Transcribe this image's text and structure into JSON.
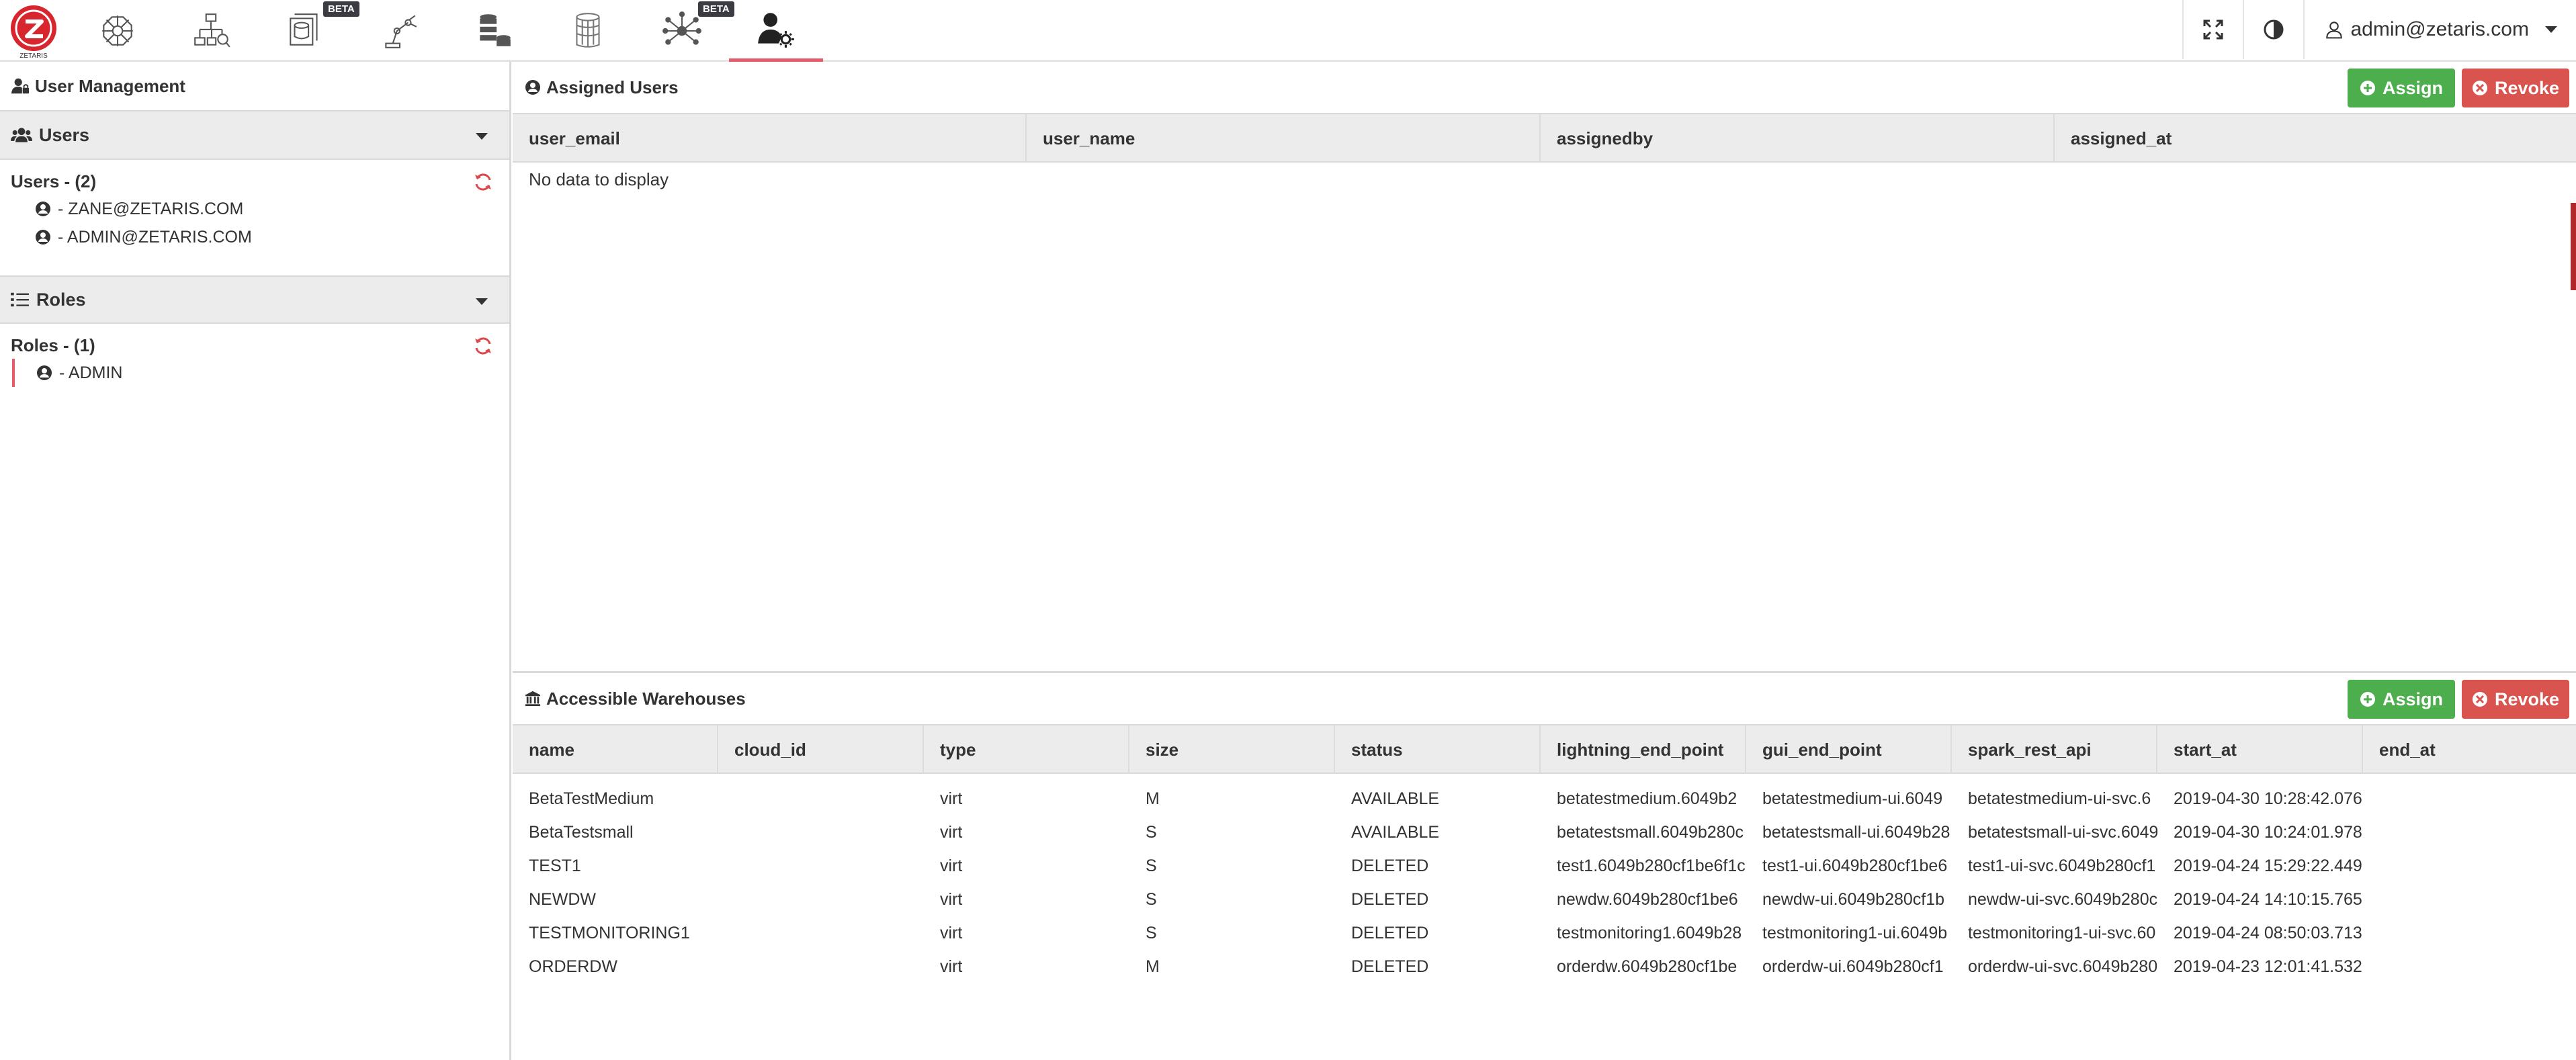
{
  "brand": {
    "logo_text": "ZETARIS",
    "accent": "#e35d6a"
  },
  "topnav": {
    "items": [
      {
        "icon": "network-hub-icon",
        "beta": ""
      },
      {
        "icon": "hierarchy-search-icon",
        "beta": ""
      },
      {
        "icon": "data-stack-icon",
        "beta": "BETA"
      },
      {
        "icon": "robot-arm-icon",
        "beta": ""
      },
      {
        "icon": "database-cluster-icon",
        "beta": ""
      },
      {
        "icon": "database-grid-icon",
        "beta": ""
      },
      {
        "icon": "neural-network-icon",
        "beta": "BETA"
      },
      {
        "icon": "user-settings-icon",
        "beta": ""
      }
    ],
    "user_label": "admin@zetaris.com"
  },
  "sidebar": {
    "title": "User Management",
    "users": {
      "section_label": "Users",
      "group_title": "Users - (2)",
      "items": [
        "- ZANE@ZETARIS.COM",
        "- ADMIN@ZETARIS.COM"
      ]
    },
    "roles": {
      "section_label": "Roles",
      "group_title": "Roles - (1)",
      "items": [
        "- ADMIN"
      ]
    }
  },
  "assigned_users": {
    "title": "Assigned Users",
    "assign_label": "Assign",
    "revoke_label": "Revoke",
    "columns": [
      "user_email",
      "user_name",
      "assignedby",
      "assigned_at"
    ],
    "empty_text": "No data to display"
  },
  "warehouses": {
    "title": "Accessible Warehouses",
    "assign_label": "Assign",
    "revoke_label": "Revoke",
    "columns": [
      "name",
      "cloud_id",
      "type",
      "size",
      "status",
      "lightning_end_point",
      "gui_end_point",
      "spark_rest_api",
      "start_at",
      "end_at"
    ],
    "rows": [
      [
        "BetaTestMedium",
        "",
        "virt",
        "M",
        "AVAILABLE",
        "betatestmedium.6049b2",
        "betatestmedium-ui.6049",
        "betatestmedium-ui-svc.6",
        "2019-04-30 10:28:42.076",
        ""
      ],
      [
        "BetaTestsmall",
        "",
        "virt",
        "S",
        "AVAILABLE",
        "betatestsmall.6049b280c",
        "betatestsmall-ui.6049b28",
        "betatestsmall-ui-svc.6049",
        "2019-04-30 10:24:01.978",
        ""
      ],
      [
        "TEST1",
        "",
        "virt",
        "S",
        "DELETED",
        "test1.6049b280cf1be6f1c",
        "test1-ui.6049b280cf1be6",
        "test1-ui-svc.6049b280cf1",
        "2019-04-24 15:29:22.449",
        ""
      ],
      [
        "NEWDW",
        "",
        "virt",
        "S",
        "DELETED",
        "newdw.6049b280cf1be6",
        "newdw-ui.6049b280cf1b",
        "newdw-ui-svc.6049b280c",
        "2019-04-24 14:10:15.765",
        ""
      ],
      [
        "TESTMONITORING1",
        "",
        "virt",
        "S",
        "DELETED",
        "testmonitoring1.6049b28",
        "testmonitoring1-ui.6049b",
        "testmonitoring1-ui-svc.60",
        "2019-04-24 08:50:03.713",
        ""
      ],
      [
        "ORDERDW",
        "",
        "virt",
        "M",
        "DELETED",
        "orderdw.6049b280cf1be",
        "orderdw-ui.6049b280cf1",
        "orderdw-ui-svc.6049b280",
        "2019-04-23 12:01:41.532",
        ""
      ]
    ]
  }
}
